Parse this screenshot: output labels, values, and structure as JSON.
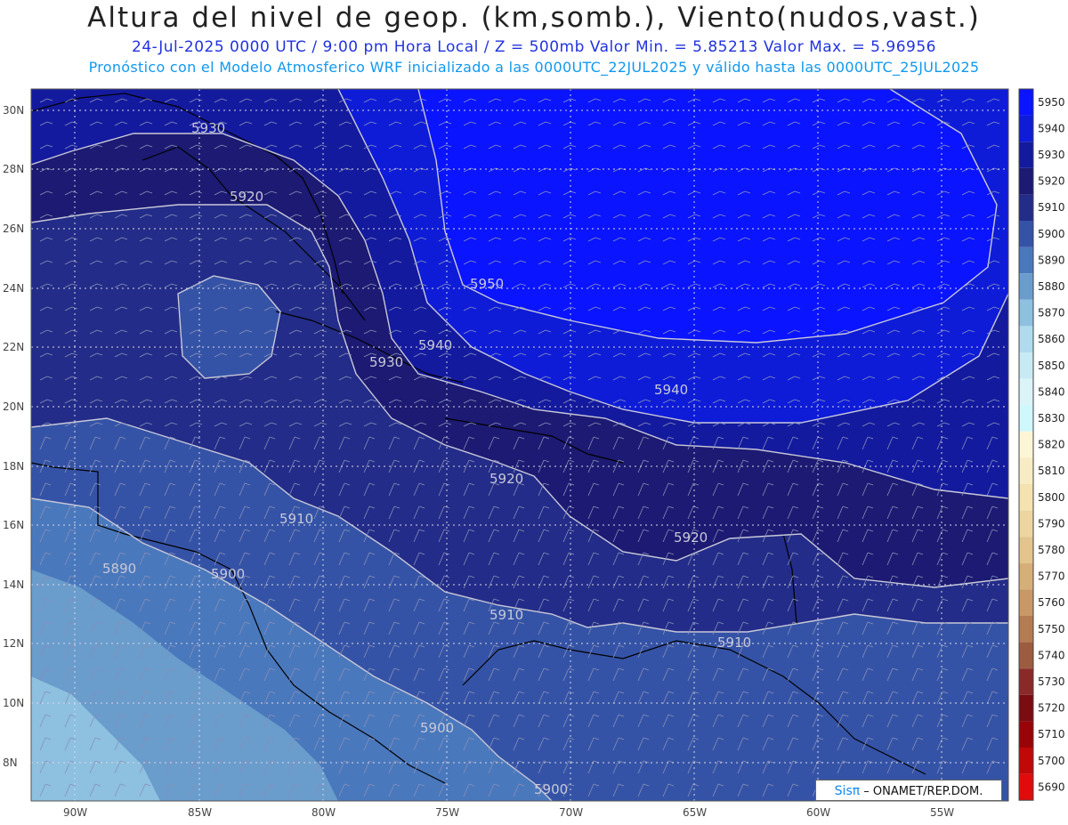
{
  "header": {
    "title": "Altura del nivel de geop. (km,somb.), Viento(nudos,vast.)",
    "subtitle1": "24-Jul-2025   0000 UTC / 9:00 pm Hora Local / Z = 500mb     Valor Min. = 5.85213  Valor Max. = 5.96956",
    "subtitle2": "Pronóstico con el Modelo Atmosferico WRF inicializado a las 0000UTC_22JUL2025 y válido hasta las  0000UTC_25JUL2025"
  },
  "axes": {
    "lon_labels": [
      "90W",
      "85W",
      "80W",
      "75W",
      "70W",
      "65W",
      "60W",
      "55W"
    ],
    "lat_labels": [
      "30N",
      "28N",
      "26N",
      "24N",
      "22N",
      "20N",
      "18N",
      "16N",
      "14N",
      "12N",
      "10N",
      "8N"
    ]
  },
  "contour_labels": [
    "5950",
    "5940",
    "5930",
    "5920",
    "5910",
    "5900",
    "5890"
  ],
  "legend": {
    "levels": [
      "5950",
      "5940",
      "5930",
      "5920",
      "5910",
      "5900",
      "5890",
      "5880",
      "5870",
      "5860",
      "5850",
      "5840",
      "5830",
      "5820",
      "5810",
      "5800",
      "5790",
      "5780",
      "5770",
      "5760",
      "5750",
      "5740",
      "5730",
      "5720",
      "5710",
      "5700",
      "5690"
    ],
    "colors": [
      "#0a14ff",
      "#0e1cd8",
      "#141a9e",
      "#1c1a72",
      "#232c88",
      "#3553a6",
      "#4a78bc",
      "#6a9ccc",
      "#8ec0e0",
      "#b0daee",
      "#c8eaf4",
      "#daf4f8",
      "#cef8fc",
      "#fdf6d6",
      "#f8ecc4",
      "#f4e2b0",
      "#ecd5a0",
      "#e2c48c",
      "#d6ae78",
      "#c89866",
      "#b47c52",
      "#9c5c40",
      "#8a2a28",
      "#7a0c12",
      "#980408",
      "#c00808",
      "#e00c0c"
    ]
  },
  "credit": {
    "brand": "Sisπ",
    "text": " – ONAMET/REP.DOM."
  }
}
